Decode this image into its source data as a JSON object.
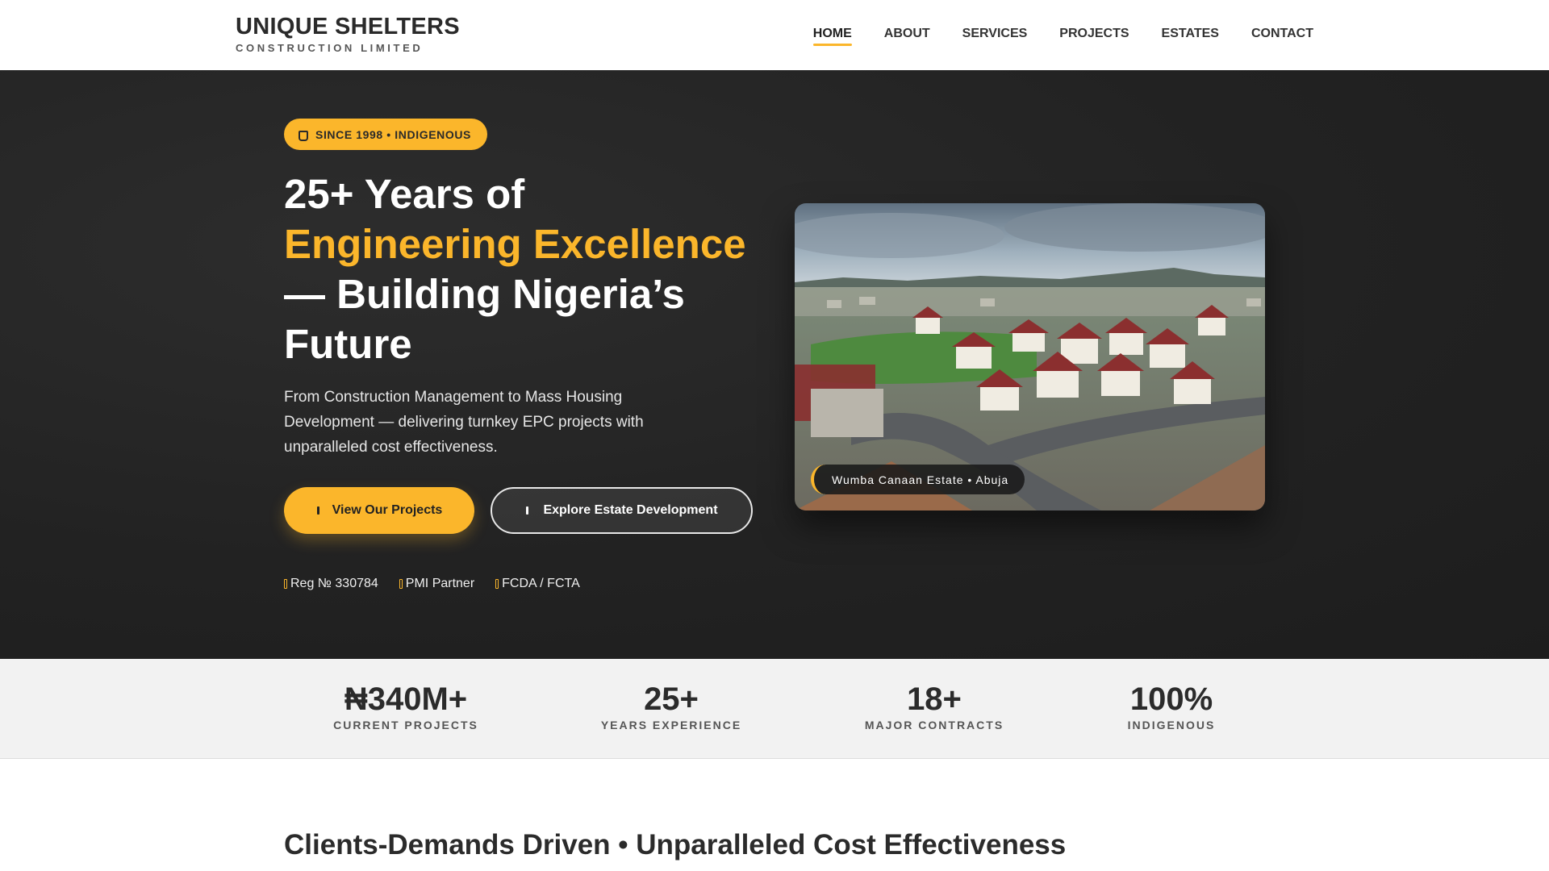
{
  "brand": {
    "title": "UNIQUE SHELTERS",
    "subtitle": "CONSTRUCTION LIMITED"
  },
  "nav": {
    "items": [
      {
        "label": "HOME",
        "active": true
      },
      {
        "label": "ABOUT",
        "active": false
      },
      {
        "label": "SERVICES",
        "active": false
      },
      {
        "label": "PROJECTS",
        "active": false
      },
      {
        "label": "ESTATES",
        "active": false
      },
      {
        "label": "CONTACT",
        "active": false
      }
    ]
  },
  "hero": {
    "badge": {
      "icon": "medal-icon",
      "text": "SINCE 1998 • INDIGENOUS"
    },
    "headline": {
      "line1": "25+ Years of",
      "accent": "Engineering Excellence",
      "line3": "— Building Nigeria’s Future"
    },
    "lede": "From Construction Management to Mass Housing Development — delivering turnkey EPC projects with unparalleled cost effectiveness.",
    "primary_button": {
      "icon": "building-icon",
      "label": "View Our Projects"
    },
    "secondary_button": {
      "icon": "map-icon",
      "label": "Explore Estate Development"
    },
    "credentials": [
      {
        "icon": "certificate-icon",
        "text": "Reg № 330784"
      },
      {
        "icon": "handshake-icon",
        "text": "PMI Partner"
      },
      {
        "icon": "shield-icon",
        "text": "FCDA / FCTA"
      }
    ],
    "photo_caption": "Wumba Canaan Estate • Abuja"
  },
  "stats": [
    {
      "value": "₦340M+",
      "label": "CURRENT PROJECTS"
    },
    {
      "value": "25+",
      "label": "YEARS EXPERIENCE"
    },
    {
      "value": "18+",
      "label": "MAJOR CONTRACTS"
    },
    {
      "value": "100%",
      "label": "INDIGENOUS"
    }
  ],
  "section": {
    "title": "Clients-Demands Driven • Unparalleled Cost Effectiveness"
  },
  "colors": {
    "accent": "#fbb62b",
    "hero_bg": "#232323",
    "stats_bg": "#f2f2f2",
    "text_dark": "#2b2b2b"
  }
}
